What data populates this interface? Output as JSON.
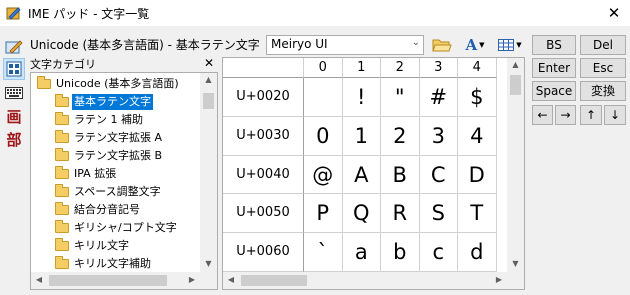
{
  "window": {
    "title": "IME パッド - 文字一覧",
    "close_glyph": "✕"
  },
  "tools": [
    {
      "name": "handwriting-tool-icon",
      "glyph": "✎"
    },
    {
      "name": "char-list-tool-icon",
      "glyph": "▤"
    },
    {
      "name": "soft-keyboard-tool-icon",
      "glyph": "▦"
    },
    {
      "name": "stroke-count-tool-icon",
      "glyph": "画"
    },
    {
      "name": "radical-tool-icon",
      "glyph": "部"
    }
  ],
  "toolbar": {
    "charset_label": "Unicode (基本多言語面) - 基本ラテン文字",
    "font_name": "Meiryo UI",
    "font_arrow": "⌄",
    "open_folder_glyph": "📂",
    "font_size_glyph": "A",
    "view_glyph": "⊞"
  },
  "category": {
    "header": "文字カテゴリ",
    "close_glyph": "✕",
    "items": [
      {
        "label": "Unicode (基本多言語面)",
        "level": 0,
        "selected": false
      },
      {
        "label": "基本ラテン文字",
        "level": 1,
        "selected": true
      },
      {
        "label": "ラテン 1 補助",
        "level": 1,
        "selected": false
      },
      {
        "label": "ラテン文字拡張 A",
        "level": 1,
        "selected": false
      },
      {
        "label": "ラテン文字拡張 B",
        "level": 1,
        "selected": false
      },
      {
        "label": "IPA 拡張",
        "level": 1,
        "selected": false
      },
      {
        "label": "スペース調整文字",
        "level": 1,
        "selected": false
      },
      {
        "label": "結合分音記号",
        "level": 1,
        "selected": false
      },
      {
        "label": "ギリシャ/コプト文字",
        "level": 1,
        "selected": false
      },
      {
        "label": "キリル文字",
        "level": 1,
        "selected": false
      },
      {
        "label": "キリル文字補助",
        "level": 1,
        "selected": false
      }
    ]
  },
  "grid": {
    "columns": [
      "0",
      "1",
      "2",
      "3",
      "4"
    ],
    "rows": [
      {
        "label": "U+0020",
        "chars": [
          "",
          "!",
          "\"",
          "#",
          "$"
        ]
      },
      {
        "label": "U+0030",
        "chars": [
          "0",
          "1",
          "2",
          "3",
          "4"
        ]
      },
      {
        "label": "U+0040",
        "chars": [
          "@",
          "A",
          "B",
          "C",
          "D"
        ]
      },
      {
        "label": "U+0050",
        "chars": [
          "P",
          "Q",
          "R",
          "S",
          "T"
        ]
      },
      {
        "label": "U+0060",
        "chars": [
          "`",
          "a",
          "b",
          "c",
          "d"
        ]
      }
    ]
  },
  "buttons": {
    "bs": "BS",
    "del": "Del",
    "enter": "Enter",
    "esc": "Esc",
    "space": "Space",
    "convert": "変換",
    "left": "←",
    "right": "→",
    "up": "↑",
    "down": "↓"
  },
  "scroll": {
    "up": "▲",
    "down": "▼",
    "left": "◀",
    "right": "▶"
  },
  "colors": {
    "accent": "#0078d7",
    "folder": "#f4cd64",
    "kanji_tool": "#a0171a"
  }
}
